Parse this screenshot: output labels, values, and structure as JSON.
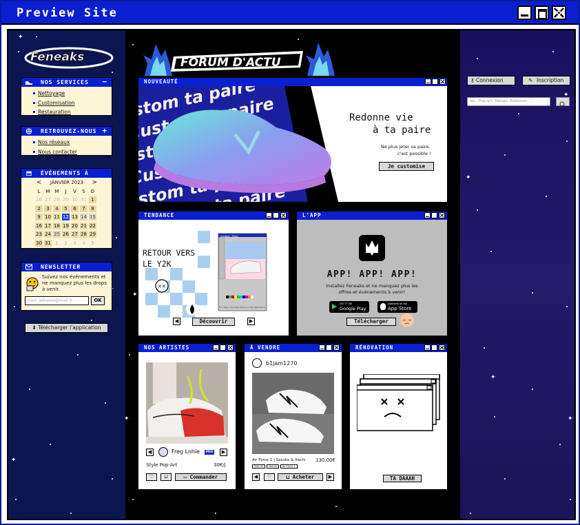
{
  "window": {
    "title": "Preview Site"
  },
  "logo": {
    "text": "Feneaks"
  },
  "banner": {
    "title": "FORUM D'ACTU"
  },
  "services": {
    "title": "NOS SERVICES",
    "toggle": "−",
    "items": [
      "Nettoyage",
      "Customisation",
      "Restauration"
    ]
  },
  "find_us": {
    "title": "RETROUVEZ-NOUS",
    "toggle": "+",
    "items": [
      "Nos réseaux",
      "Nous contacter"
    ]
  },
  "events": {
    "title": "ÉVÉNEMENTS À VENIR",
    "month": "JANVIER 2023",
    "prev": "<",
    "next": ">",
    "weekdays": [
      "L",
      "M",
      "M",
      "J",
      "V",
      "S",
      "D"
    ],
    "weeks": [
      [
        "26",
        "27",
        "28",
        "29",
        "30",
        "31",
        "1"
      ],
      [
        "2",
        "3",
        "4",
        "5",
        "6",
        "7",
        "8"
      ],
      [
        "9",
        "10",
        "11",
        "12",
        "13",
        "14",
        "15"
      ],
      [
        "16",
        "17",
        "18",
        "19",
        "20",
        "21",
        "22"
      ],
      [
        "23",
        "24",
        "25",
        "26",
        "27",
        "28",
        "29"
      ],
      [
        "30",
        "31",
        "1",
        "2",
        "3",
        "4",
        "5"
      ]
    ]
  },
  "newsletter": {
    "title": "NEWSLETTER",
    "text": "Suivez nos événements et ne manquez plus les drops à venir.",
    "placeholder": "mon_adresse@mail.fr",
    "ok": "OK"
  },
  "download_app": "Télécharger l'application",
  "auth": {
    "login": "Connexion",
    "signup": "Inscription"
  },
  "search": {
    "placeholder": "ex : Pop-art, Manga, Pokemon, ..."
  },
  "nouveaute": {
    "title": "NOUVEAUTÉ",
    "bg_text": "Custom ta paire",
    "headline": "Redonne vie à ta paire",
    "sub": "Ne plus jeter sa paire, c'est possible !",
    "cta": "Je customise"
  },
  "tendance": {
    "title": "TENDANCE",
    "headline_1": "RETOUR VERS",
    "headline_2": "LE Y2K",
    "cta": "Découvrir",
    "prev": "◀",
    "next": "▶",
    "mini_title": "untitled - Paint",
    "mini_menu": [
      "File",
      "Edit",
      "View",
      "Image",
      "Colors",
      "Help"
    ],
    "mini_status": "For Help, click Help Topics on the Help Menu."
  },
  "app": {
    "title": "L'APP",
    "headline": "APP! APP! APP!",
    "text": "Installez Feneaks et ne manquez plus les offres et événements à venir!",
    "google_small": "GET IT ON",
    "google": "Google Play",
    "apple_small": "Available on the",
    "apple": "App Store",
    "cta": "Télécharger"
  },
  "artists": {
    "title": "NOS ARTISTES",
    "name": "Freg Lohle",
    "badge": "PRO",
    "style": "Style Pop-Art",
    "price": "30€/j",
    "cta": "Commander",
    "prev": "◀",
    "next": "▶"
  },
  "sale": {
    "title": "À VENDRE",
    "user": "b1jam1270",
    "product": "Air Force 1 | Sasuke & Itachi",
    "price": "130,00€",
    "tags": [
      "Sole 40",
      "Naruto",
      "Air Force 1"
    ],
    "cta": "Acheter",
    "prev": "◀",
    "next": "▶"
  },
  "renovation": {
    "title": "RÉNOVATION",
    "cta": "TA DAAAH"
  },
  "colors": {
    "blue": "#0a1fd0",
    "panel_bg": "#fff6d6",
    "center_bg": "#000000",
    "left_bg": "#0b1650",
    "app_bg": "#bdbdbd"
  }
}
